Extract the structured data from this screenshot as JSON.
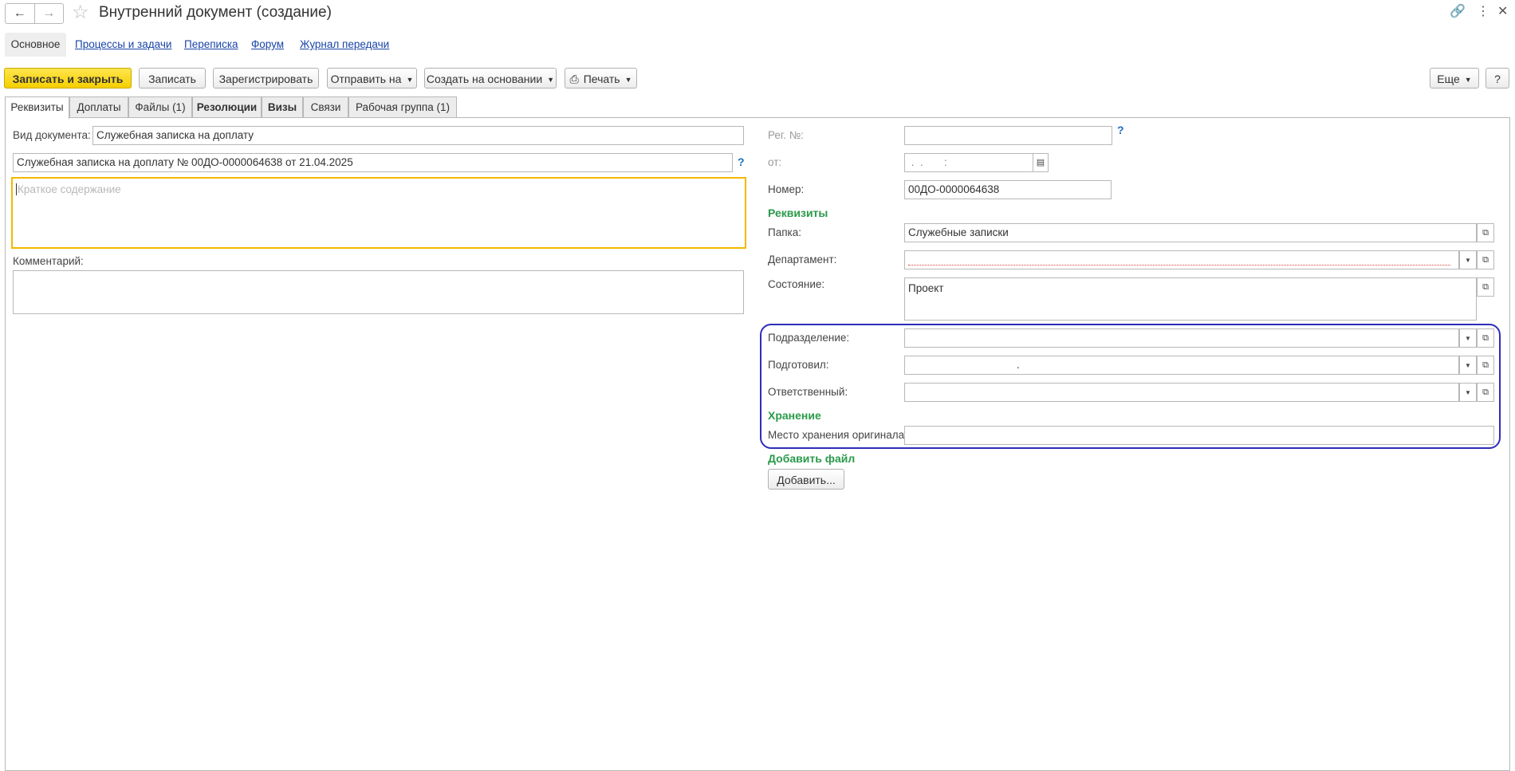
{
  "window": {
    "title": "Внутренний документ (создание)"
  },
  "sections": [
    "Основное",
    "Процессы и задачи",
    "Переписка",
    "Форум",
    "Журнал передачи"
  ],
  "toolbar": {
    "save_close": "Записать и закрыть",
    "save": "Записать",
    "register": "Зарегистрировать",
    "send": "Отправить на",
    "create_based": "Создать на основании",
    "print": "Печать",
    "more": "Еще",
    "help": "?"
  },
  "tabs": [
    "Реквизиты",
    "Доплаты",
    "Файлы (1)",
    "Резолюции",
    "Визы",
    "Связи",
    "Рабочая группа (1)"
  ],
  "left": {
    "doc_type_label": "Вид документа:",
    "doc_type_value": "Служебная записка на доплату",
    "doc_title_value": "Служебная записка на доплату № 00ДО-0000064638 от 21.04.2025",
    "summary_placeholder": "Краткое содержание",
    "comment_label": "Комментарий:"
  },
  "right": {
    "reg_no_label": "Рег. №:",
    "from_label": "от:",
    "date_placeholder": " .  .       :  ",
    "number_label": "Номер:",
    "number_value": "00ДО-0000064638",
    "group_requisites": "Реквизиты",
    "folder_label": "Папка:",
    "folder_value": "Служебные записки",
    "department_label": "Департамент:",
    "state_label": "Состояние:",
    "state_value": "Проект",
    "division_label": "Подразделение:",
    "prepared_label": "Подготовил:",
    "prepared_value": ".",
    "responsible_label": "Ответственный:",
    "group_storage": "Хранение",
    "storage_label": "Место хранения оригинала:",
    "group_add_file": "Добавить файл",
    "add_button": "Добавить..."
  },
  "colors": {
    "primary_button": "#f5cf00",
    "group_header": "#2a9a4a",
    "link": "#1a45a8",
    "focus_border": "#f5b800",
    "highlight_frame": "#2d2db8"
  }
}
